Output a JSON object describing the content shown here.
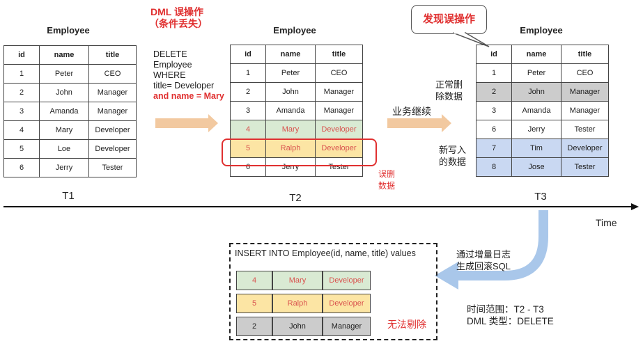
{
  "annotations": {
    "dml_error_title": "DML 误操作",
    "dml_error_subtitle": "（条件丢失）",
    "sql_lines": [
      "DELETE",
      "Employee",
      "WHERE",
      "title= Developer"
    ],
    "sql_missing_condition": "and name = Mary",
    "business_continues": "业务继续",
    "discover_error_bubble": "发现误操作",
    "normal_delete_label": [
      "正常删",
      "除数据"
    ],
    "new_data_label": [
      "新写入",
      "的数据"
    ],
    "mis_deleted_label": [
      "误删",
      "数据"
    ],
    "rollback_label": [
      "通过增量日志",
      "生成回滚SQL"
    ],
    "time_range": "时间范围：T2 - T3",
    "dml_type": "DML 类型：DELETE",
    "cannot_remove": "无法剔除",
    "insert_statement": "INSERT INTO Employee(id, name, title) values"
  },
  "timeline": {
    "axis_label": "Time",
    "t1": "T1",
    "t2": "T2",
    "t3": "T3"
  },
  "columns": [
    "id",
    "name",
    "title"
  ],
  "tables": {
    "t1": {
      "title": "Employee",
      "rows": [
        [
          "1",
          "Peter",
          "CEO"
        ],
        [
          "2",
          "John",
          "Manager"
        ],
        [
          "3",
          "Amanda",
          "Manager"
        ],
        [
          "4",
          "Mary",
          "Developer"
        ],
        [
          "5",
          "Loe",
          "Developer"
        ],
        [
          "6",
          "Jerry",
          "Tester"
        ]
      ]
    },
    "t2": {
      "title": "Employee",
      "rows": [
        [
          "1",
          "Peter",
          "CEO"
        ],
        [
          "2",
          "John",
          "Manager"
        ],
        [
          "3",
          "Amanda",
          "Manager"
        ],
        [
          "4",
          "Mary",
          "Developer"
        ],
        [
          "5",
          "Ralph",
          "Developer"
        ],
        [
          "6",
          "Jerry",
          "Tester"
        ]
      ]
    },
    "t3": {
      "title": "Employee",
      "rows": [
        [
          "1",
          "Peter",
          "CEO"
        ],
        [
          "2",
          "John",
          "Manager"
        ],
        [
          "3",
          "Amanda",
          "Manager"
        ],
        [
          "6",
          "Jerry",
          "Tester"
        ],
        [
          "7",
          "Tim",
          "Developer"
        ],
        [
          "8",
          "Jose",
          "Tester"
        ]
      ]
    },
    "rollback": {
      "rows": [
        [
          "4",
          "Mary",
          "Developer"
        ],
        [
          "5",
          "Ralph",
          "Developer"
        ],
        [
          "2",
          "John",
          "Manager"
        ]
      ]
    }
  },
  "colors": {
    "green": "#d9ead3",
    "yellow": "#fce5a4",
    "grey": "#cccccc",
    "blue": "#c9d8f2",
    "red": "#e03030"
  }
}
